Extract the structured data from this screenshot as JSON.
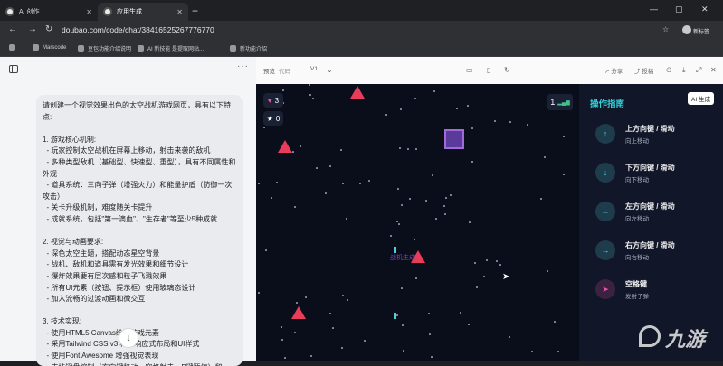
{
  "tabs": [
    {
      "label": "AI 创作",
      "active": false
    },
    {
      "label": "应用生成",
      "active": true
    }
  ],
  "address_bar": {
    "url": "doubao.com/code/chat/38416525267776770",
    "new_tab_label": "新标签"
  },
  "bookmarks": [
    "Marscode",
    "豆包功能介绍说明",
    "AI 新技能 是提取网站...",
    "新功能介绍"
  ],
  "left_panel": {
    "message": "请创建一个视觉效果出色的太空战机游戏网页，具有以下特点:\n\n1. 游戏核心机制:\n  - 玩家控制太空战机在屏幕上移动，射击来袭的敌机\n  - 多种类型敌机（基础型、快速型、重型），具有不同属性和外观\n  - 道具系统：三向子弹（增强火力）和能量护盾（防御一次攻击）\n  - 关卡升级机制，难度随关卡提升\n  - 成就系统，包括\"第一滴血\"、\"生存者\"等至少5种成就\n\n2. 视觉与动画要求:\n  - 深色太空主题，搭配动态星空背景\n  - 战机、敌机和道具需有发光效果和细节设计\n  - 爆炸效果要有层次感和粒子飞溅效果\n  - 所有UI元素（按钮、提示框）使用玻璃态设计\n  - 加入流畅的过渡动画和微交互\n\n3. 技术实现:\n  - 使用HTML5 Canvas绘制游戏元素\n  - 采用Tailwind CSS v3 构建响应式布局和UI样式\n  - 使用Font Awesome 增强视觉表现\n  - 支持键盘控制（方向键移动，空格射击，P键暂停）和"
  },
  "toolbar": {
    "view_preview": "预览",
    "view_code": "代码",
    "version": "V1",
    "share_label": "分享",
    "post_label": "投稿"
  },
  "game": {
    "lives": "3",
    "score": "0",
    "level": "1",
    "enemy_label": "战机生成"
  },
  "guide": {
    "title": "操作指南",
    "ai_badge": "AI 生成",
    "items": [
      {
        "key": "上方向键 / 滑动",
        "desc": "向上移动",
        "icon": "arrow-up-icon"
      },
      {
        "key": "下方向键 / 滑动",
        "desc": "向下移动",
        "icon": "arrow-down-icon"
      },
      {
        "key": "左方向键 / 滑动",
        "desc": "向左移动",
        "icon": "arrow-left-icon"
      },
      {
        "key": "右方向键 / 滑动",
        "desc": "向右移动",
        "icon": "arrow-right-icon"
      },
      {
        "key": "空格键",
        "desc": "发射子弹",
        "icon": "fire-icon"
      }
    ]
  },
  "watermark": "九游",
  "colors": {
    "accent_cyan": "#33d0d8",
    "enemy_red": "#e83c5a",
    "heart_pink": "#e8569c",
    "game_bg": "#0a0d1a",
    "guide_bg": "#111729"
  }
}
